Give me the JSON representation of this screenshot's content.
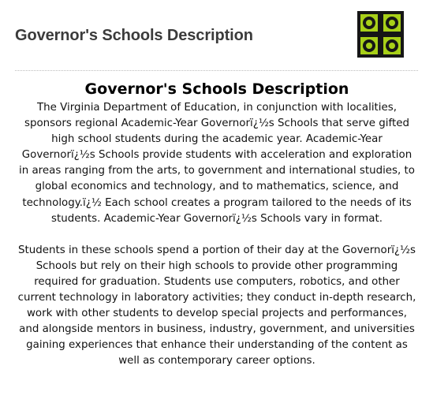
{
  "header": {
    "title": "Governor's Schools Description",
    "logo": {
      "icon": "four-rings-logo-icon",
      "colors": {
        "background": "#161616",
        "accent": "#a8d018"
      }
    }
  },
  "content": {
    "title": "Governor's Schools Description",
    "paragraphs": [
      "The Virginia Department of Education, in conjunction with localities, sponsors regional Academic-Year Governorï¿½s Schools that serve gifted high school students during the academic year. Academic-Year Governorï¿½s Schools provide students with acceleration and exploration in areas ranging from the arts, to government and international studies, to global economics and technology, and to mathematics, science, and technology.ï¿½ Each school creates a program tailored to the needs of its students. Academic-Year Governorï¿½s Schools vary in format.",
      "Students in these schools spend a portion of their day at the Governorï¿½s Schools but rely on their high schools to provide other programming required for graduation. Students use computers, robotics, and other current technology in laboratory activities; they conduct in-depth research, work with other students to develop special projects and performances, and alongside mentors in business, industry, government, and universities gaining experiences that enhance their understanding of the content as well as contemporary career options."
    ]
  }
}
